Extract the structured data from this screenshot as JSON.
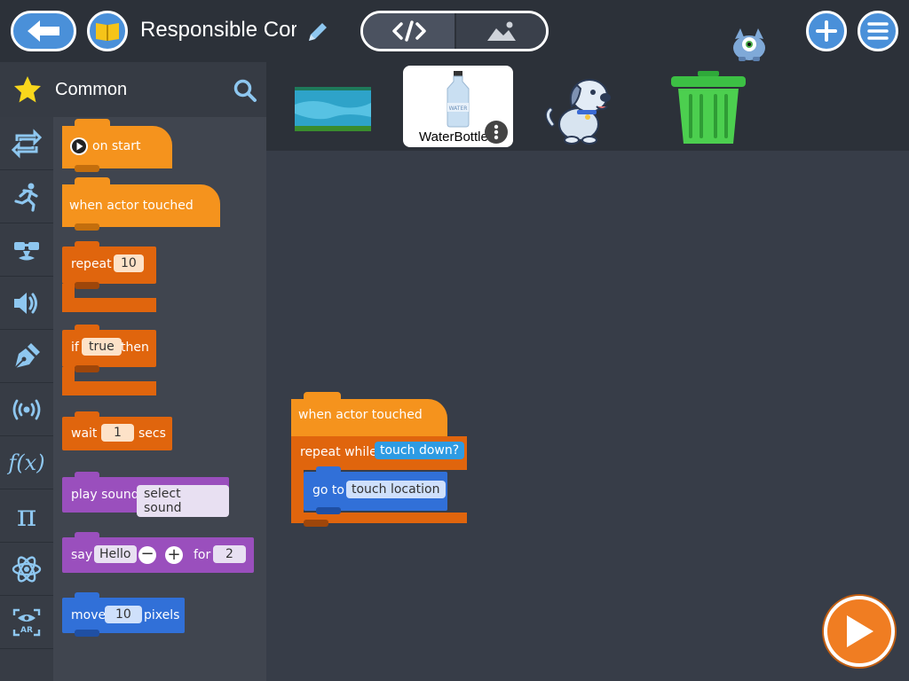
{
  "toolbar": {
    "back_icon": "back-arrow-icon",
    "book_icon": "book-icon",
    "project_title": "Responsible Cor",
    "edit_icon": "pencil-icon",
    "code_tab_icon": "code-icon",
    "stage_tab_icon": "image-icon",
    "add_icon": "plus-icon",
    "menu_icon": "hamburger-menu-icon"
  },
  "palette": {
    "category_title": "Common",
    "categories": [
      "control",
      "motion",
      "looks",
      "sound",
      "drawing",
      "sensing",
      "functions",
      "math",
      "physics",
      "ar"
    ],
    "blocks": {
      "on_start": "on start",
      "when_touched": "when actor touched",
      "repeat": "repeat",
      "repeat_count": "10",
      "if": "if",
      "if_value": "true",
      "then": "then",
      "wait": "wait",
      "wait_value": "1",
      "secs": "secs",
      "play_sound": "play sound",
      "sound_value": "select sound",
      "say": "say",
      "say_value": "Hello",
      "for": "for",
      "for_value": "2",
      "move": "move",
      "move_value": "10",
      "pixels": "pixels"
    }
  },
  "actors": {
    "selected_label": "WaterBottle",
    "bottle_text": "WATER"
  },
  "canvas": {
    "when_touched": "when actor touched",
    "repeat_while": "repeat while",
    "condition": "touch down?",
    "go_to": "go to",
    "target": "touch location"
  },
  "colors": {
    "event": "#f5931d",
    "control": "#e0650d",
    "sound": "#9a4fbd",
    "motion": "#3170d8",
    "accent": "#4a90d9",
    "play": "#f07d22"
  }
}
